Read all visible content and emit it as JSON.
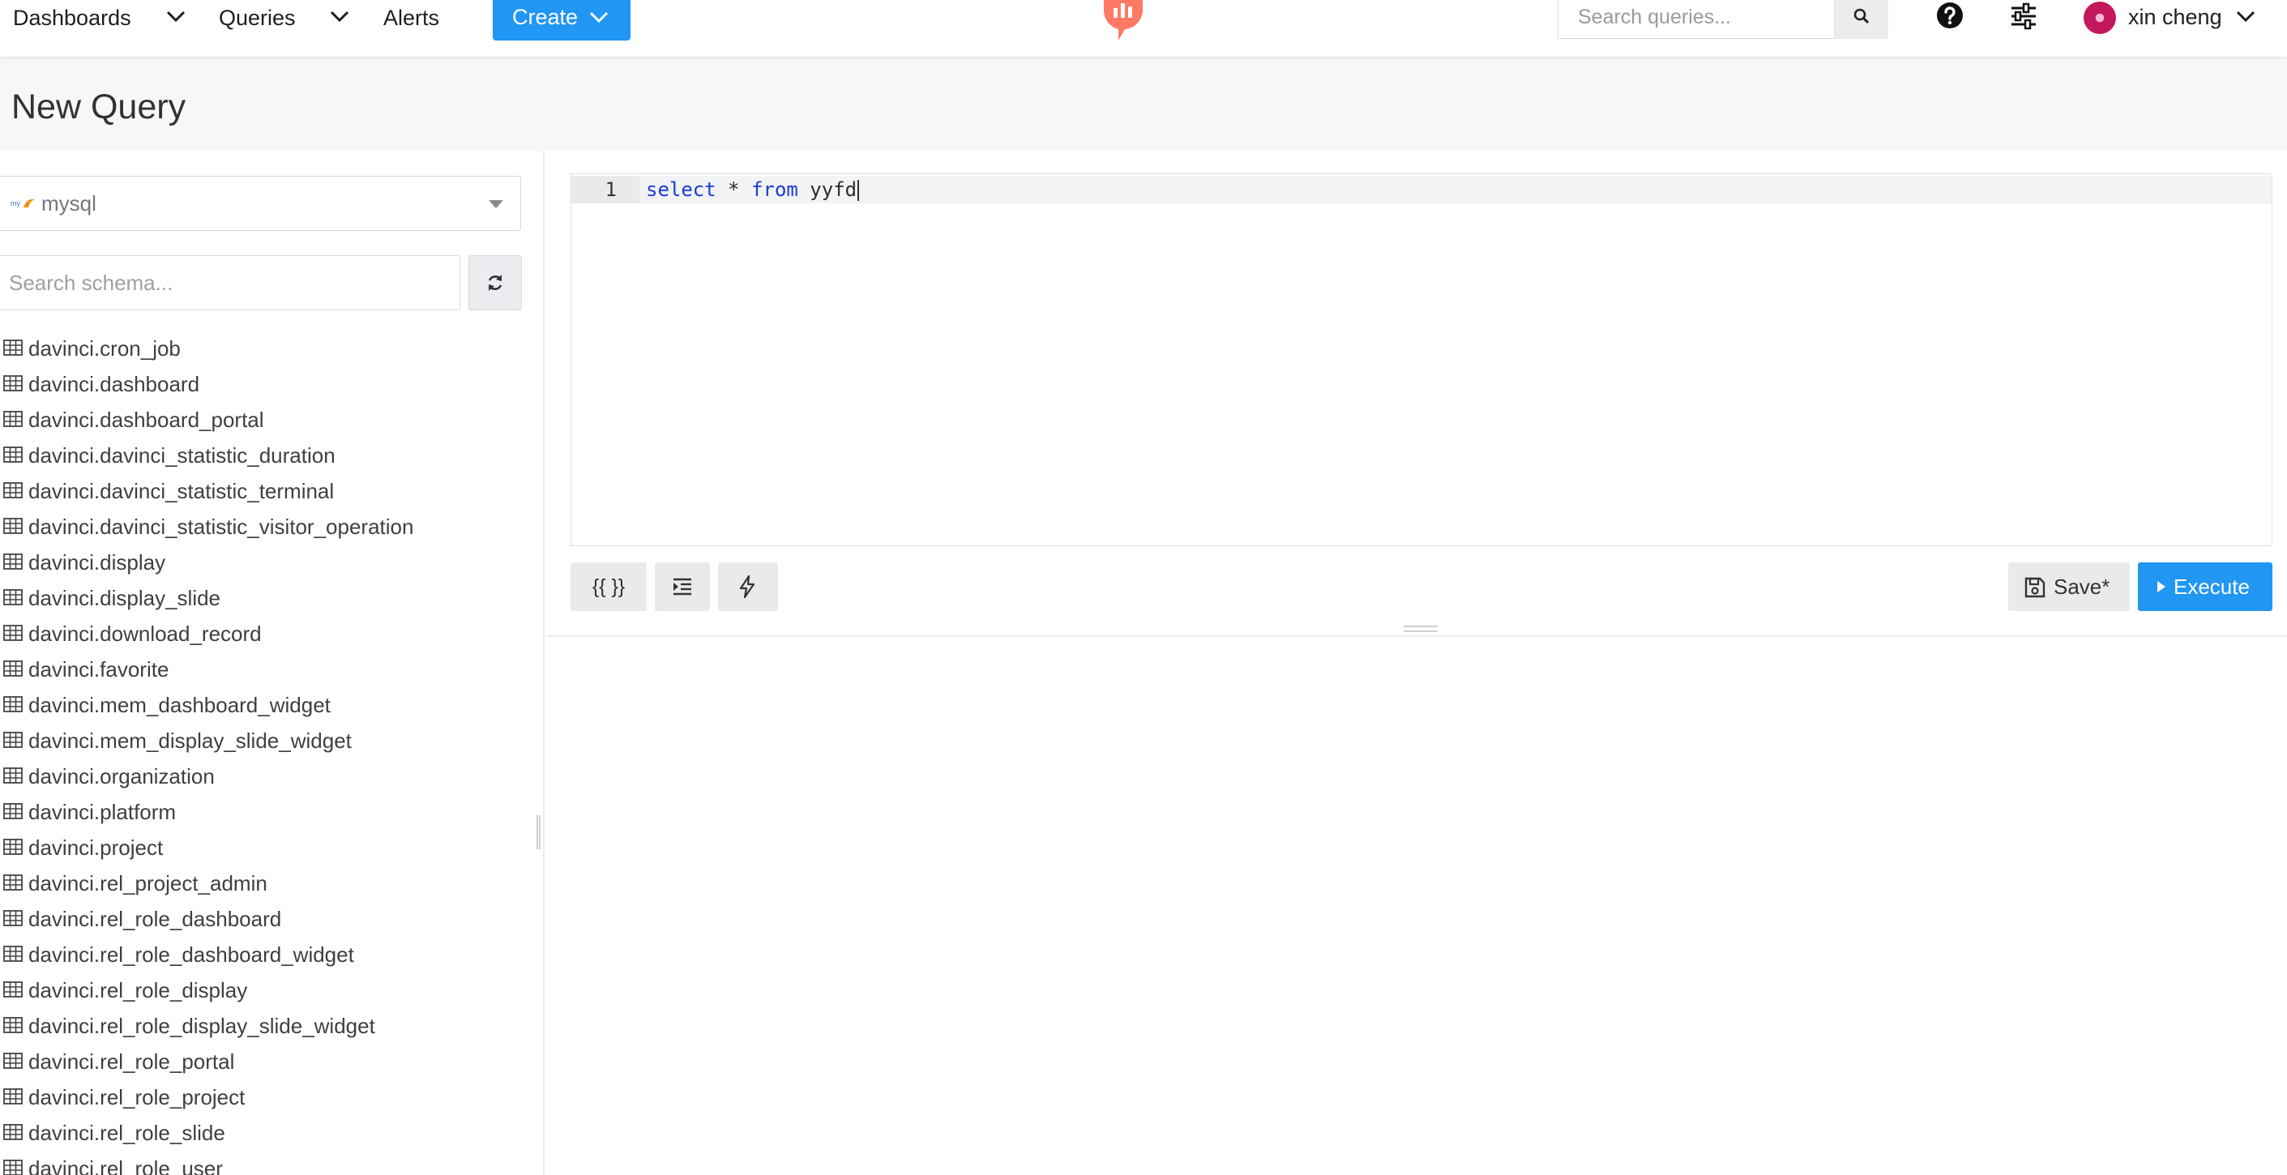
{
  "nav": {
    "dashboards_label": "Dashboards",
    "queries_label": "Queries",
    "alerts_label": "Alerts",
    "create_label": "Create",
    "search_placeholder": "Search queries...",
    "user_name": "xin cheng"
  },
  "colors": {
    "accent": "#2196f3",
    "logo": "#ff7964",
    "sql_keyword": "#1b3bd6"
  },
  "page": {
    "title": "New Query"
  },
  "schema": {
    "data_source": "mysql",
    "search_placeholder": "Search schema...",
    "tables": [
      "davinci.cron_job",
      "davinci.dashboard",
      "davinci.dashboard_portal",
      "davinci.davinci_statistic_duration",
      "davinci.davinci_statistic_terminal",
      "davinci.davinci_statistic_visitor_operation",
      "davinci.display",
      "davinci.display_slide",
      "davinci.download_record",
      "davinci.favorite",
      "davinci.mem_dashboard_widget",
      "davinci.mem_display_slide_widget",
      "davinci.organization",
      "davinci.platform",
      "davinci.project",
      "davinci.rel_project_admin",
      "davinci.rel_role_dashboard",
      "davinci.rel_role_dashboard_widget",
      "davinci.rel_role_display",
      "davinci.rel_role_display_slide_widget",
      "davinci.rel_role_portal",
      "davinci.rel_role_project",
      "davinci.rel_role_slide",
      "davinci.rel_role_user"
    ]
  },
  "editor": {
    "line_number": "1",
    "kw_select": "select",
    "star": " * ",
    "kw_from": "from",
    "table_name": " yyfd"
  },
  "toolbar": {
    "params_label": "{{ }}",
    "save_label": "Save*",
    "execute_label": "Execute"
  },
  "icons": {
    "nav_chevrons": "chevron-down-icon",
    "search": "search-icon",
    "help": "question-circle-icon",
    "settings": "sliders-icon",
    "refresh": "refresh-icon",
    "table": "table-icon",
    "indent": "indent-icon",
    "autocomplete": "lightning-bolt-icon",
    "save": "floppy-disk-icon",
    "execute": "play-icon"
  }
}
